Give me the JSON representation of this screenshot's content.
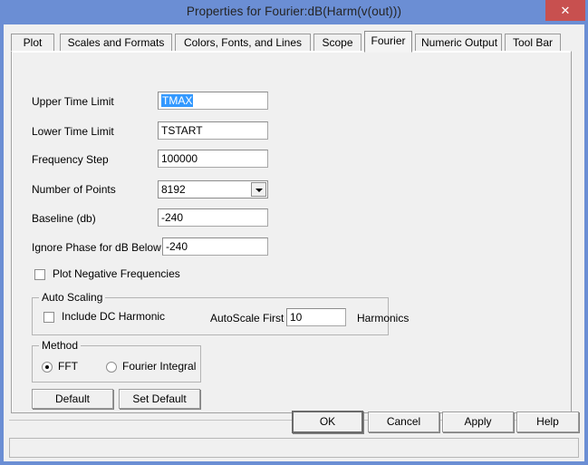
{
  "window": {
    "title": "Properties for Fourier:dB(Harm(v(out)))",
    "close_glyph": "✕",
    "frame_color": "#6b8ed4",
    "close_color": "#c8504f",
    "selection_color": "#3399ff"
  },
  "tabs": [
    {
      "label": "Plot",
      "selected": false
    },
    {
      "label": "Scales and Formats",
      "selected": false
    },
    {
      "label": "Colors, Fonts, and Lines",
      "selected": false
    },
    {
      "label": "Scope",
      "selected": false
    },
    {
      "label": "Fourier",
      "selected": true
    },
    {
      "label": "Numeric Output",
      "selected": false
    },
    {
      "label": "Tool Bar",
      "selected": false
    }
  ],
  "fields": {
    "upper_time_limit": {
      "label": "Upper Time Limit",
      "value": "TMAX",
      "selected": true
    },
    "lower_time_limit": {
      "label": "Lower Time Limit",
      "value": "TSTART",
      "selected": false
    },
    "frequency_step": {
      "label": "Frequency Step",
      "value": "100000",
      "selected": false
    },
    "number_of_points": {
      "label": "Number of Points",
      "value": "8192"
    },
    "baseline_db": {
      "label": "Baseline (db)",
      "value": "-240",
      "selected": false
    },
    "ignore_phase": {
      "label": "Ignore Phase for dB Below",
      "value": "-240",
      "selected": false
    }
  },
  "plot_negative_frequencies": {
    "label": "Plot Negative Frequencies",
    "checked": false
  },
  "auto_scaling": {
    "group_title": "Auto Scaling",
    "include_dc_harmonic": {
      "label": "Include DC Harmonic",
      "checked": false
    },
    "autoscale_first_label": "AutoScale First",
    "autoscale_first_value": "10",
    "harmonics_label": "Harmonics"
  },
  "method": {
    "group_title": "Method",
    "options": [
      {
        "label": "FFT",
        "selected": true
      },
      {
        "label": "Fourier Integral",
        "selected": false
      }
    ]
  },
  "default_buttons": {
    "default_label": "Default",
    "set_default_label": "Set Default"
  },
  "dialog_buttons": {
    "ok_label": "OK",
    "cancel_label": "Cancel",
    "apply_label": "Apply",
    "help_label": "Help"
  },
  "statusbar": {
    "text": ""
  }
}
